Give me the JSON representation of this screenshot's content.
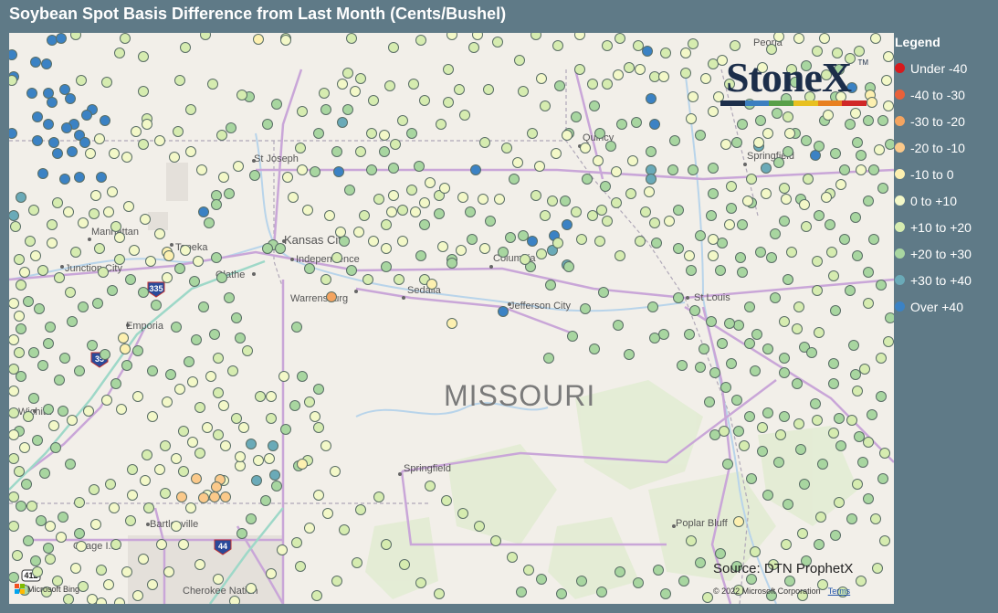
{
  "title": "Soybean Spot Basis Difference from Last Month (Cents/Bushel)",
  "legend": {
    "title": "Legend",
    "items": [
      {
        "label": "Under -40",
        "color": "#d7191c"
      },
      {
        "label": "-40 to -30",
        "color": "#e8613a"
      },
      {
        "label": "-30 to -20",
        "color": "#f4a460"
      },
      {
        "label": "-20 to -10",
        "color": "#fbc98a"
      },
      {
        "label": "-10 to 0",
        "color": "#fdf0b0"
      },
      {
        "label": "0 to +10",
        "color": "#f3f8c8"
      },
      {
        "label": "+10 to +20",
        "color": "#d6ecb0"
      },
      {
        "label": "+20 to +30",
        "color": "#a8d6a0"
      },
      {
        "label": "+30 to +40",
        "color": "#6aaab8"
      },
      {
        "label": "Over +40",
        "color": "#3b82c4"
      }
    ]
  },
  "logo": {
    "text": "StoneX",
    "tm": "TM",
    "stripe_colors": [
      "#1c2e4a",
      "#3c7fc0",
      "#58a048",
      "#e8c020",
      "#e88020",
      "#d02828"
    ]
  },
  "map": {
    "state_label": "MISSOURI",
    "cities": [
      "Peoria",
      "St Joseph",
      "Quincy",
      "Springfield",
      "Manhattan",
      "Topeka",
      "Kansas City",
      "Independence",
      "Junction City",
      "Columbia",
      "Olathe",
      "Warrensburg",
      "Sedalia",
      "St Louis",
      "Jefferson City",
      "Emporia",
      "Wichita",
      "Springfield",
      "Bartlesville",
      "Osage I.R.",
      "Poplar Bluff",
      "Cherokee Nation"
    ],
    "shields": [
      "335",
      "35",
      "44",
      "412"
    ]
  },
  "source": "Source: DTN ProphetX",
  "attribution": {
    "bing": "Microsoft Bing",
    "copyright": "© 2022 Microsoft Corporation",
    "terms": "Terms"
  }
}
